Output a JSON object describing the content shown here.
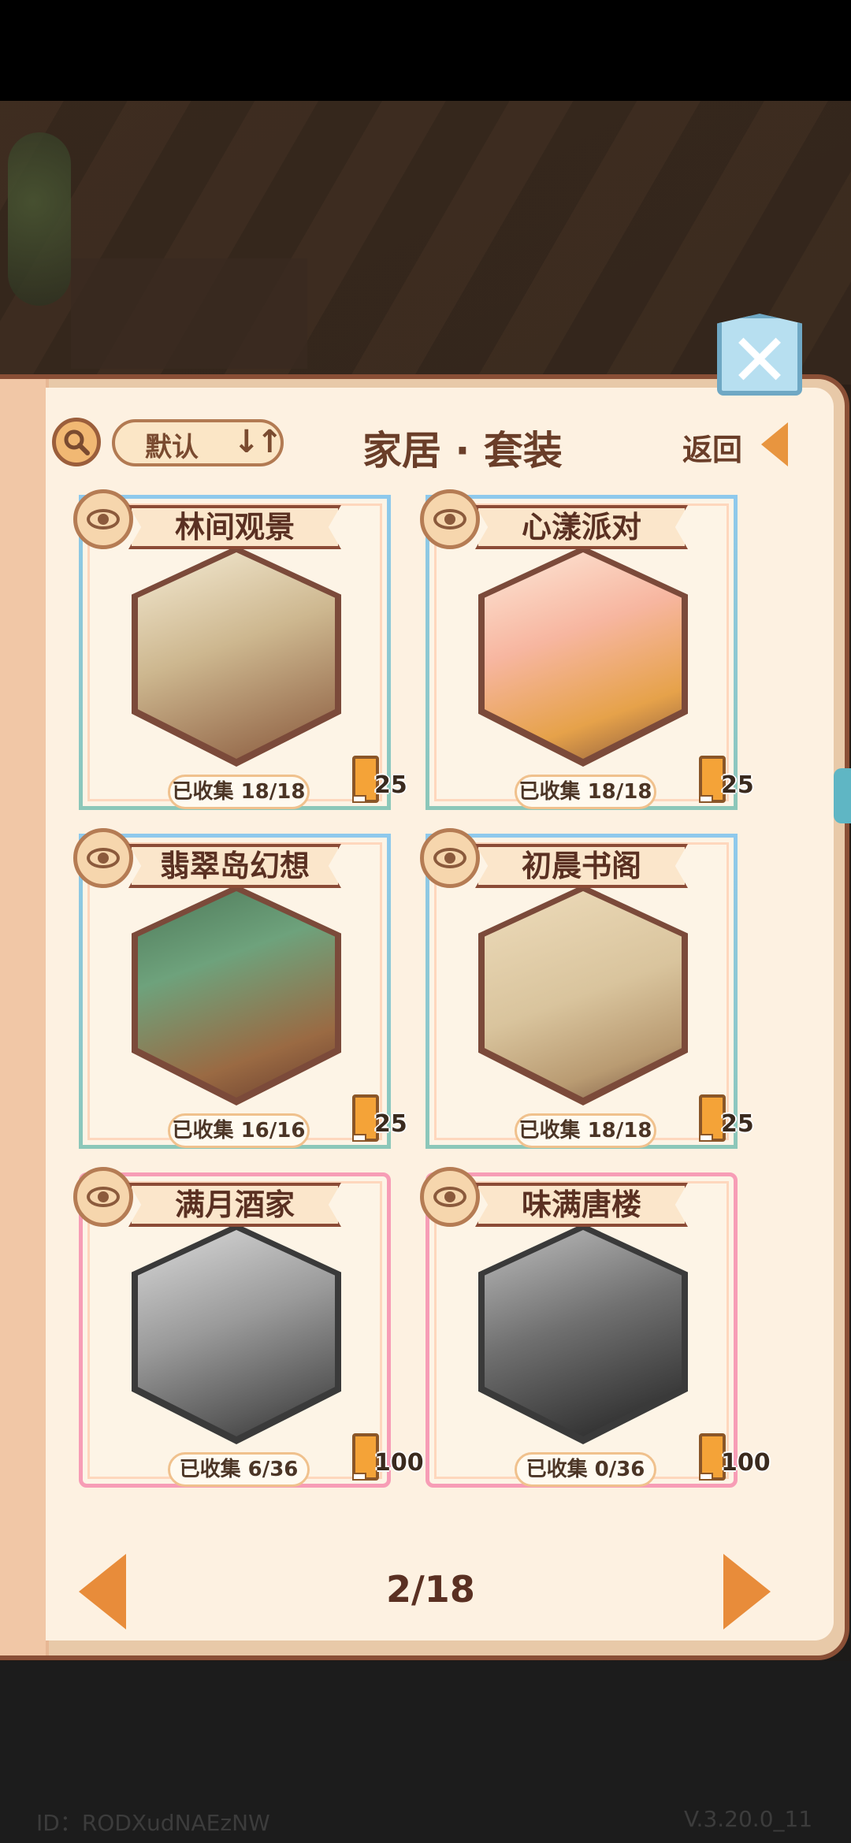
{
  "header": {
    "sort_label": "默认",
    "sort_icon": "↓↑",
    "title": "家居 · 套装",
    "back_label": "返回"
  },
  "icons": {
    "close": "close-x-icon",
    "search": "magnifier-icon",
    "eye": "eye-icon",
    "book": "book-icon",
    "prev": "left-arrow-icon",
    "next": "right-arrow-icon"
  },
  "colors": {
    "accent_orange": "#e88c3a",
    "card_blue_border": "#8ec9ec",
    "card_pink_border": "#f79db6",
    "title_brown": "#6a3e29"
  },
  "sets": [
    {
      "name": "林间观景",
      "collected": "已收集 18/18",
      "reward": "25",
      "unlocked": true
    },
    {
      "name": "心漾派对",
      "collected": "已收集 18/18",
      "reward": "25",
      "unlocked": true
    },
    {
      "name": "翡翠岛幻想",
      "collected": "已收集 16/16",
      "reward": "25",
      "unlocked": true
    },
    {
      "name": "初晨书阁",
      "collected": "已收集 18/18",
      "reward": "25",
      "unlocked": true
    },
    {
      "name": "满月酒家",
      "collected": "已收集 6/36",
      "reward": "100",
      "unlocked": false
    },
    {
      "name": "味满唐楼",
      "collected": "已收集 0/36",
      "reward": "100",
      "unlocked": false
    }
  ],
  "pagination": {
    "page": "2/18"
  },
  "footer": {
    "id": "ID：RODXudNAEzNW",
    "version": "V.3.20.0_11"
  }
}
